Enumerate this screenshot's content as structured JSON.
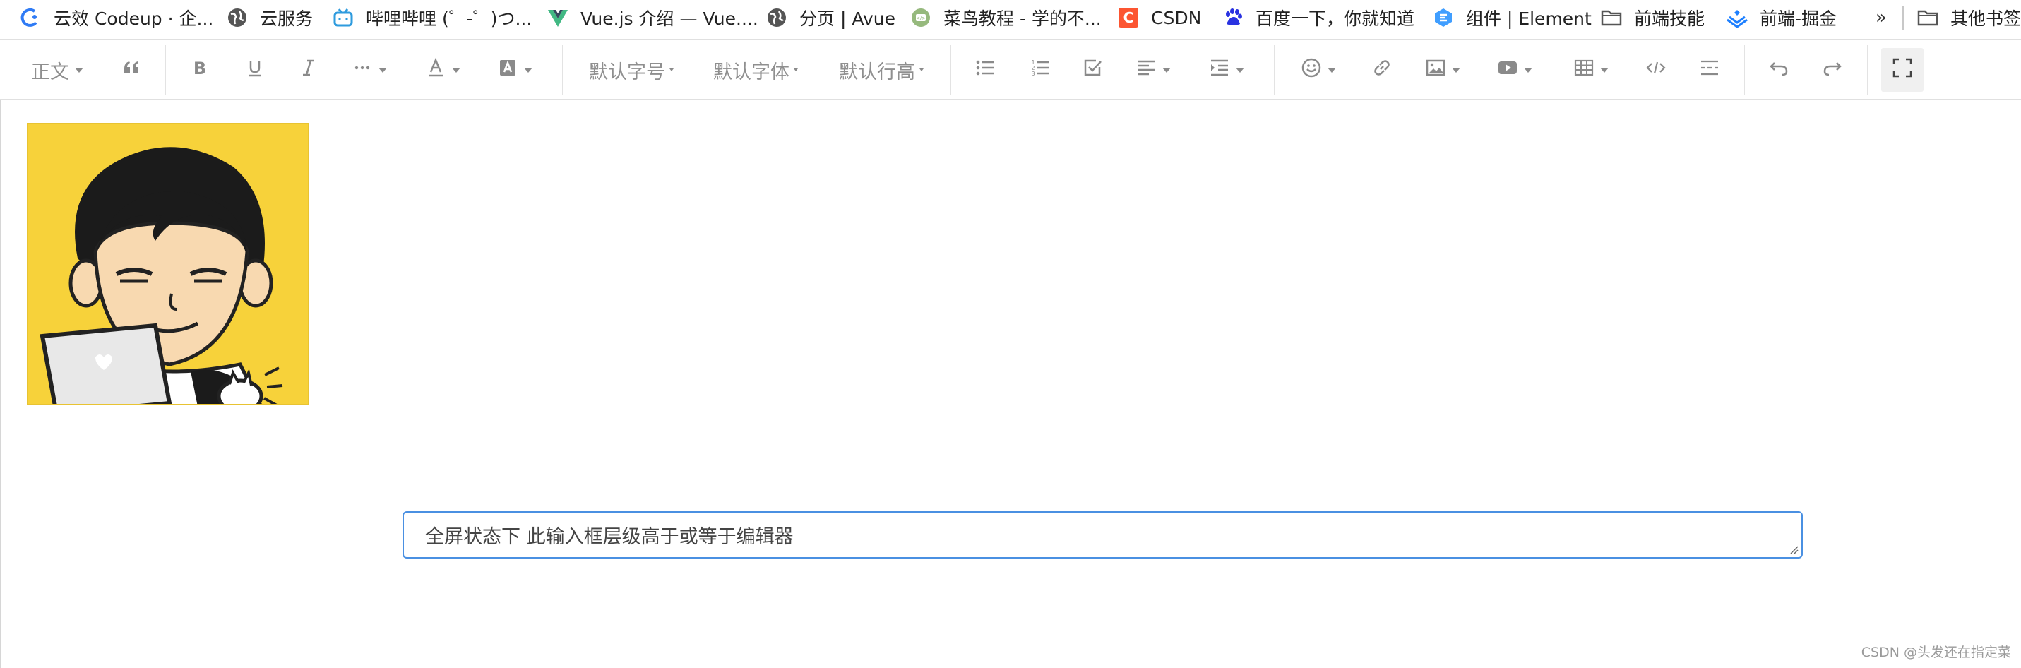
{
  "bookmarks": {
    "items": [
      {
        "label": "云效 Codeup · 企...",
        "icon": "codeup-icon"
      },
      {
        "label": "云服务",
        "icon": "globe-icon"
      },
      {
        "label": "哔哩哔哩 (゜-゜)つ...",
        "icon": "bilibili-icon"
      },
      {
        "label": "Vue.js 介绍 — Vue....",
        "icon": "vue-icon"
      },
      {
        "label": "分页 | Avue",
        "icon": "globe-icon"
      },
      {
        "label": "菜鸟教程 - 学的不...",
        "icon": "runoob-icon"
      },
      {
        "label": "CSDN",
        "icon": "csdn-icon"
      },
      {
        "label": "百度一下，你就知道",
        "icon": "baidu-icon"
      },
      {
        "label": "组件 | Element",
        "icon": "element-icon"
      },
      {
        "label": "前端技能",
        "icon": "folder-icon"
      },
      {
        "label": "前端-掘金",
        "icon": "juejin-icon"
      }
    ],
    "more": "»",
    "other": "其他书签"
  },
  "toolbar": {
    "paragraph": "正文",
    "font_size": "默认字号",
    "font_family": "默认字体",
    "line_height": "默认行高"
  },
  "editor": {
    "overlay_input": "全屏状态下  此输入框层级高于或等于编辑器"
  },
  "watermark": "CSDN @头发还在指定菜"
}
